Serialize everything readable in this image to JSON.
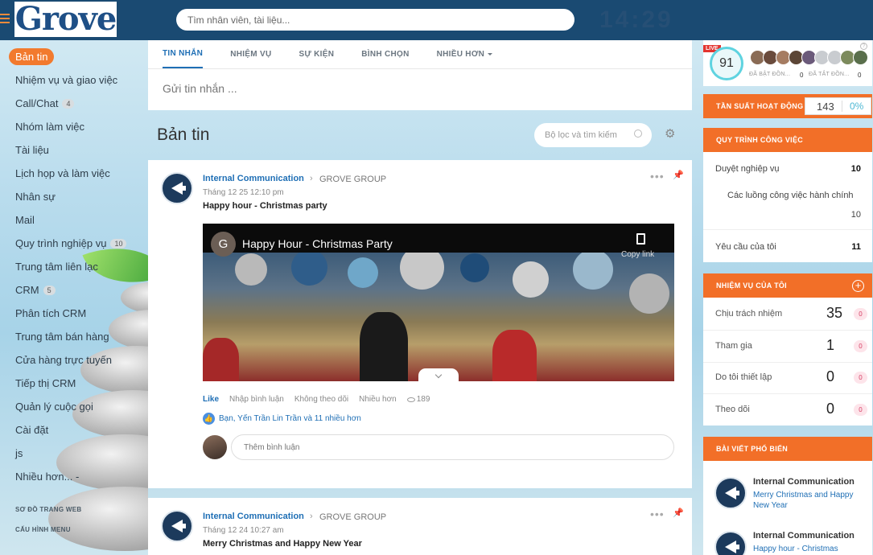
{
  "header": {
    "logo_text": "Grove",
    "search_placeholder": "Tìm nhân viên, tài liệu...",
    "clock": "14:29"
  },
  "sidebar": {
    "items": [
      {
        "label": "Bản tin",
        "active": true
      },
      {
        "label": "Nhiệm vụ và giao việc"
      },
      {
        "label": "Call/Chat",
        "count": "4"
      },
      {
        "label": "Nhóm làm việc"
      },
      {
        "label": "Tài liệu"
      },
      {
        "label": "Lịch họp và làm việc"
      },
      {
        "label": "Nhân sự"
      },
      {
        "label": "Mail"
      },
      {
        "label": "Quy trình nghiệp vụ",
        "count": "10"
      },
      {
        "label": "Trung tâm liên lạc"
      },
      {
        "label": "CRM",
        "count": "5"
      },
      {
        "label": "Phân tích CRM"
      },
      {
        "label": "Trung tâm bán hàng"
      },
      {
        "label": "Cửa hàng trực tuyến"
      },
      {
        "label": "Tiếp thị CRM"
      },
      {
        "label": "Quản lý cuộc gọi"
      },
      {
        "label": "Cài đặt"
      },
      {
        "label": "js"
      },
      {
        "label": "Nhiều hơn... -"
      }
    ],
    "footer": [
      "SƠ ĐỒ TRANG WEB",
      "CẤU HÌNH MENU"
    ]
  },
  "composer": {
    "tabs": [
      "TIN NHẮN",
      "NHIỆM VỤ",
      "SỰ KIỆN",
      "BÌNH CHỌN",
      "NHIỀU HƠN"
    ],
    "placeholder": "Gửi tin nhắn ..."
  },
  "feed": {
    "title": "Bản tin",
    "filter_placeholder": "Bộ lọc và tìm kiếm"
  },
  "posts": [
    {
      "author": "Internal Communication",
      "group": "GROVE GROUP",
      "time": "Tháng 12 25 12:10 pm",
      "title": "Happy hour - Christmas party",
      "video": {
        "channel_letter": "G",
        "title": "Happy Hour - Christmas Party",
        "copy_label": "Copy link"
      },
      "actions": {
        "like": "Like",
        "comment": "Nhập bình luận",
        "unfollow": "Không theo dõi",
        "more": "Nhiều hơn",
        "views": "189"
      },
      "likers": "Bạn, Yến Trần Lin Trần và 11 nhiều hơn",
      "comment_placeholder": "Thêm bình luận"
    },
    {
      "author": "Internal Communication",
      "group": "GROVE GROUP",
      "time": "Tháng 12 24 10:27 am",
      "title": "Merry Christmas and Happy New Year"
    }
  ],
  "right": {
    "live": {
      "badge": "LIVE",
      "score": "91",
      "in_label": "ĐÃ BẬT ĐỒN...",
      "in_value": "0",
      "out_label": "ĐÃ TẮT ĐỒN...",
      "out_value": "0"
    },
    "frequency": {
      "label": "TẦN SUẤT HOẠT ĐỘNG",
      "value": "143",
      "percent": "0%"
    },
    "workflow": {
      "title": "QUY TRÌNH CÔNG VIỆC",
      "rows": [
        {
          "label": "Duyệt nghiệp vụ",
          "value": "10"
        },
        {
          "label": "Các luồng công việc hành chính",
          "value": "10"
        },
        {
          "label": "Yêu cầu của tôi",
          "value": "11"
        }
      ]
    },
    "tasks": {
      "title": "NHIỆM VỤ CỦA TÔI",
      "rows": [
        {
          "label": "Chịu trách nhiệm",
          "value": "35",
          "badge": "0"
        },
        {
          "label": "Tham gia",
          "value": "1",
          "badge": "0"
        },
        {
          "label": "Do tôi thiết lập",
          "value": "0",
          "badge": "0"
        },
        {
          "label": "Theo dõi",
          "value": "0",
          "badge": "0"
        }
      ]
    },
    "popular": {
      "title": "BÀI VIẾT PHỔ BIẾN",
      "items": [
        {
          "author": "Internal Communication",
          "title": "Merry Christmas and Happy New Year"
        },
        {
          "author": "Internal Communication",
          "title": "Happy hour - Christmas"
        }
      ]
    }
  }
}
